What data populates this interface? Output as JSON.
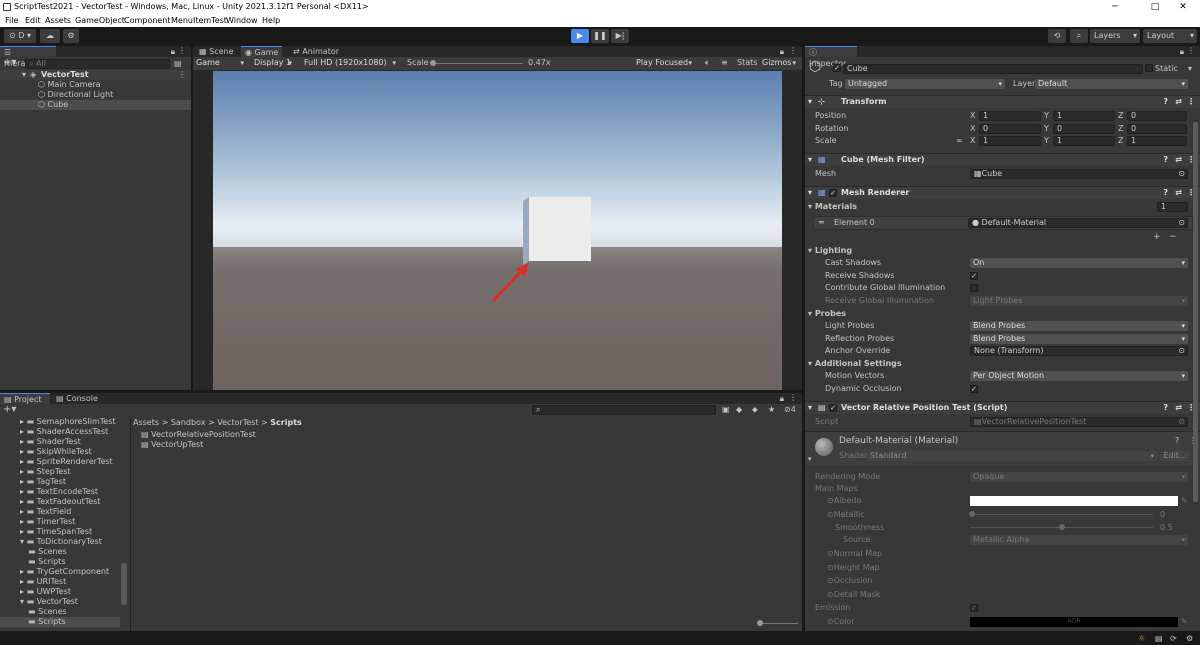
{
  "window": {
    "title": "ScriptTest2021 - VectorTest - Windows, Mac, Linux - Unity 2021.3.12f1 Personal <DX11>",
    "minimize": "─",
    "maximize": "□",
    "close": "✕"
  },
  "menu": [
    "File",
    "Edit",
    "Assets",
    "GameObject",
    "Component",
    "MenuItemTest",
    "Window",
    "Help"
  ],
  "toolbar": {
    "account": "D",
    "layers": "Layers",
    "layout": "Layout"
  },
  "hierarchy": {
    "tab": "Hierarchy",
    "search_placeholder": "All",
    "scene": "VectorTest",
    "items": [
      "Main Camera",
      "Directional Light",
      "Cube"
    ]
  },
  "game": {
    "tabs": [
      "Scene",
      "Game",
      "Animator"
    ],
    "display_mode": "Game",
    "display": "Display 1",
    "resolution": "Full HD (1920x1080)",
    "scale_label": "Scale",
    "scale_value": "0.47x",
    "play_focused": "Play Focused",
    "stats": "Stats",
    "gizmos": "Gizmos"
  },
  "project": {
    "tabs": [
      "Project",
      "Console"
    ],
    "tree": [
      {
        "label": "SemaphoreSlimTest",
        "indent": 1
      },
      {
        "label": "ShaderAccessTest",
        "indent": 1
      },
      {
        "label": "ShaderTest",
        "indent": 1
      },
      {
        "label": "SkipWhileTest",
        "indent": 1
      },
      {
        "label": "SpriteRendererTest",
        "indent": 1
      },
      {
        "label": "StepTest",
        "indent": 1
      },
      {
        "label": "TagTest",
        "indent": 1
      },
      {
        "label": "TextEncodeTest",
        "indent": 1
      },
      {
        "label": "TextFadeoutTest",
        "indent": 1
      },
      {
        "label": "TextField",
        "indent": 1
      },
      {
        "label": "TimerTest",
        "indent": 1
      },
      {
        "label": "TimeSpanTest",
        "indent": 1
      },
      {
        "label": "ToDictionaryTest",
        "indent": 1
      },
      {
        "label": "Scenes",
        "indent": 2
      },
      {
        "label": "Scripts",
        "indent": 2
      },
      {
        "label": "TryGetComponent",
        "indent": 1
      },
      {
        "label": "URITest",
        "indent": 1
      },
      {
        "label": "UWPTest",
        "indent": 1
      },
      {
        "label": "VectorTest",
        "indent": 1
      },
      {
        "label": "Scenes",
        "indent": 2
      },
      {
        "label": "Scripts",
        "indent": 2
      }
    ],
    "breadcrumb": [
      "Assets",
      "Sandbox",
      "VectorTest",
      "Scripts"
    ],
    "files": [
      "VectorRelativePositionTest",
      "VectorUpTest"
    ],
    "hidden_count": "4"
  },
  "inspector": {
    "tab": "Inspector",
    "name": "Cube",
    "static": "Static",
    "tag_label": "Tag",
    "tag": "Untagged",
    "layer_label": "Layer",
    "layer": "Default",
    "transform": {
      "title": "Transform",
      "position": "Position",
      "rotation": "Rotation",
      "scale": "Scale",
      "pos": [
        "1",
        "1",
        "0"
      ],
      "rot": [
        "0",
        "0",
        "0"
      ],
      "scl": [
        "1",
        "1",
        "1"
      ],
      "axes": [
        "X",
        "Y",
        "Z"
      ]
    },
    "mesh_filter": {
      "title": "Cube (Mesh Filter)",
      "mesh_label": "Mesh",
      "mesh": "Cube"
    },
    "mesh_renderer": {
      "title": "Mesh Renderer",
      "materials": "Materials",
      "materials_count": "1",
      "element": "Element 0",
      "material": "Default-Material",
      "lighting": "Lighting",
      "cast_shadows": "Cast Shadows",
      "cast_shadows_val": "On",
      "receive_shadows": "Receive Shadows",
      "contribute_gi": "Contribute Global Illumination",
      "receive_gi": "Receive Global Illumination",
      "receive_gi_val": "Light Probes",
      "probes": "Probes",
      "light_probes": "Light Probes",
      "light_probes_val": "Blend Probes",
      "reflection_probes": "Reflection Probes",
      "reflection_probes_val": "Blend Probes",
      "anchor_override": "Anchor Override",
      "anchor_override_val": "None (Transform)",
      "additional": "Additional Settings",
      "motion_vectors": "Motion Vectors",
      "motion_vectors_val": "Per Object Motion",
      "dynamic_occlusion": "Dynamic Occlusion"
    },
    "script_comp": {
      "title": "Vector Relative Position Test (Script)",
      "script_label": "Script",
      "script": "VectorRelativePositionTest"
    },
    "material": {
      "title": "Default-Material (Material)",
      "shader_label": "Shader",
      "shader": "Standard",
      "edit": "Edit...",
      "rendering_mode": "Rendering Mode",
      "rendering_mode_val": "Opaque",
      "main_maps": "Main Maps",
      "albedo": "Albedo",
      "metallic": "Metallic",
      "metallic_val": "0",
      "smoothness": "Smoothness",
      "smoothness_val": "0.5",
      "source": "Source",
      "source_val": "Metallic Alpha",
      "normal_map": "Normal Map",
      "height_map": "Height Map",
      "occlusion": "Occlusion",
      "detail_mask": "Detail Mask",
      "emission": "Emission",
      "color": "Color",
      "hdr": "HDR"
    }
  },
  "colors": {
    "accent": "#4a8ae8",
    "sky_top": "#5b7fae",
    "sky_horizon": "#e8eef3",
    "ground": "#6e6361",
    "arrow": "#d8312b",
    "cube_front": "#ececec",
    "cube_side": "#9aa9c2"
  }
}
